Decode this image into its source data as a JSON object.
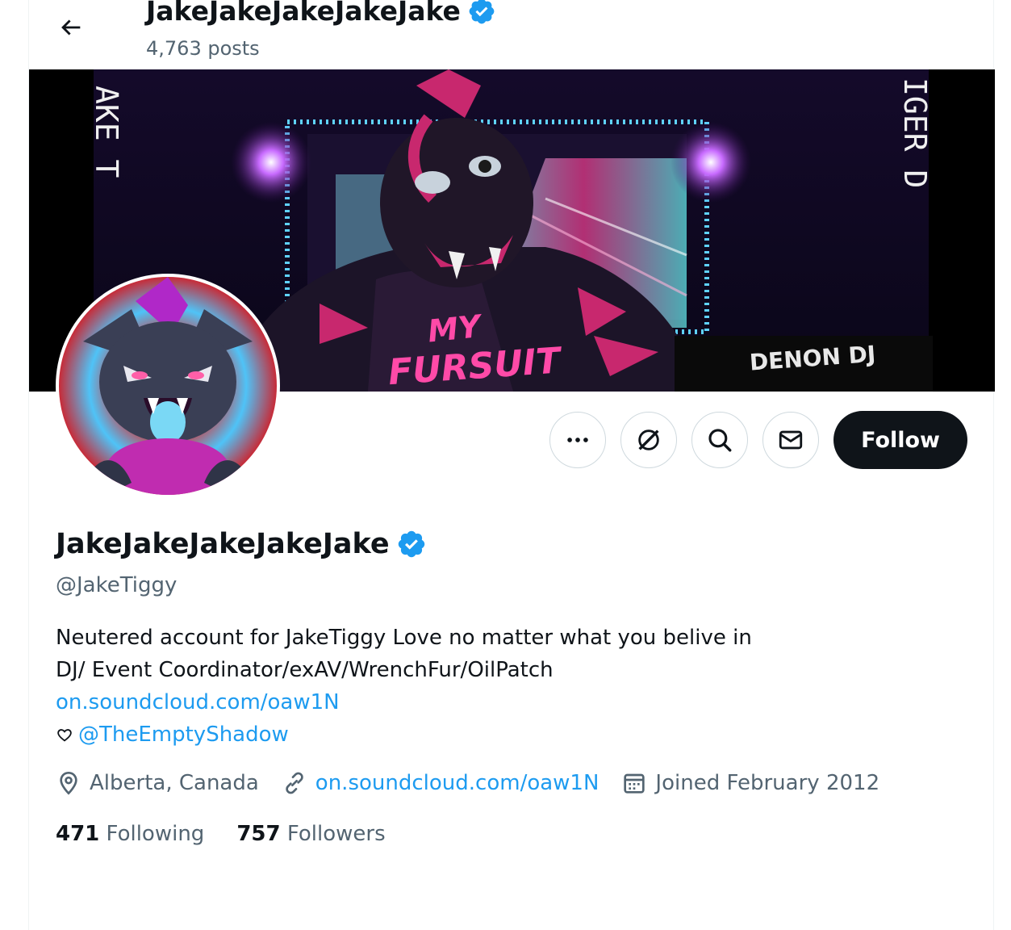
{
  "header": {
    "title": "JakeJakeJakeJakeJake",
    "post_count": "4,763 posts"
  },
  "banner": {
    "side_text_left": "AKE T",
    "side_text_right": "IGER D",
    "shirt_line1": "MY",
    "shirt_line2": "FURSUIT",
    "brand": "DENON DJ"
  },
  "actions": {
    "follow_label": "Follow",
    "more_icon": "more-icon",
    "grok_icon": "grok-icon",
    "search_icon": "search-icon",
    "message_icon": "envelope-icon"
  },
  "profile": {
    "name": "JakeJakeJakeJakeJake",
    "handle": "@JakeTiggy",
    "bio_line1": "Neutered account for JakeTiggy Love no matter what you belive in",
    "bio_line2": "DJ/ Event Coordinator/exAV/WrenchFur/OilPatch",
    "bio_link": "on.soundcloud.com/oaw1N",
    "bio_mention": "@TheEmptyShadow",
    "location": "Alberta, Canada",
    "website": "on.soundcloud.com/oaw1N",
    "joined": "Joined February 2012"
  },
  "stats": {
    "following_count": "471",
    "following_label": "Following",
    "followers_count": "757",
    "followers_label": "Followers"
  },
  "colors": {
    "accent": "#1d9bf0",
    "text": "#0f1419",
    "muted": "#536471",
    "verified": "#1d9bf0"
  }
}
